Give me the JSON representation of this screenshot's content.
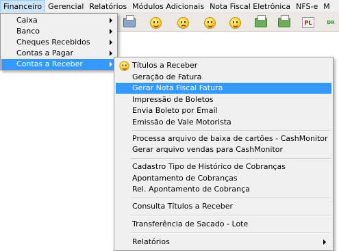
{
  "menubar": {
    "items": [
      "Financeiro",
      "Gerencial",
      "Relatórios",
      "Módulos Adicionais",
      "Nota Fiscal Eletrônica",
      "NFS-e",
      "M"
    ]
  },
  "toolbar": {
    "icons": [
      "printer-icon",
      "smiley-icon",
      "sad-smiley-icon",
      "smiley-icon",
      "smiley-icon",
      "green-printer-icon",
      "green-printer-icon",
      "pl-icon",
      "dr-icon"
    ],
    "pl_label": "PL",
    "dr_label": "DR"
  },
  "dropdown": {
    "items": [
      {
        "label": "Caixa",
        "has_submenu": true
      },
      {
        "label": "Banco",
        "has_submenu": true
      },
      {
        "label": "Cheques Recebidos",
        "has_submenu": true
      },
      {
        "label": "Contas a Pagar",
        "has_submenu": true
      },
      {
        "label": "Contas a Receber",
        "has_submenu": true,
        "selected": true
      }
    ]
  },
  "submenu": {
    "items": [
      {
        "label": "Títulos a Receber",
        "icon": "smiley-icon"
      },
      {
        "label": "Geração de Fatura"
      },
      {
        "label": "Gerar Nota Fiscal Fatura",
        "highlighted": true
      },
      {
        "label": "Impressão de Boletos"
      },
      {
        "label": "Envia Boleto por Email"
      },
      {
        "label": "Emissão de Vale Motorista"
      },
      {
        "label": "Processa arquivo de baixa de cartões - CashMonitor"
      },
      {
        "label": "Gerar arquivo vendas para CashMonitor"
      },
      {
        "label": "Cadastro Tipo de Histórico de Cobranças"
      },
      {
        "label": "Apontamento de Cobranças"
      },
      {
        "label": "Rel. Apontamento de Cobrança"
      },
      {
        "label": "Consulta Títulos a Receber"
      },
      {
        "label": "Transferência de Sacado - Lote"
      },
      {
        "label": "Relatórios",
        "has_submenu": true
      }
    ]
  },
  "colors": {
    "highlight": "#3399ff",
    "menu_bg": "#f0f0f0"
  }
}
